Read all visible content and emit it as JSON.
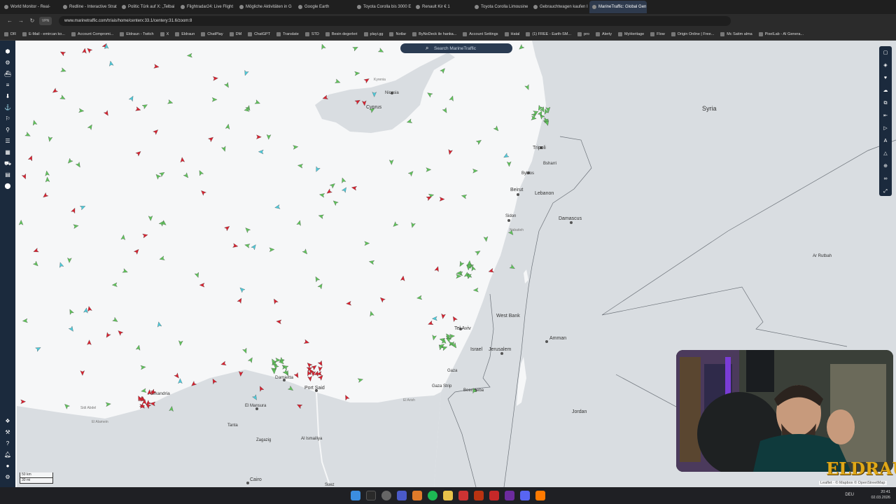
{
  "browser": {
    "tabs": [
      {
        "title": "World Monitor - Real-",
        "active": false
      },
      {
        "title": "Redline - Interactive Strat",
        "active": false
      },
      {
        "title": "Politic Türk auf X: „Telbai",
        "active": false
      },
      {
        "title": "Flightradar24: Live Flight",
        "active": false
      },
      {
        "title": "Mögliche Aktivitäten in G",
        "active": false
      },
      {
        "title": "Google Earth",
        "active": false
      },
      {
        "title": "Toyota Corolla bis 3000 E",
        "active": false
      },
      {
        "title": "Renault Kir € 1",
        "active": false
      },
      {
        "title": "Toyota Corolla Limousine",
        "active": false
      },
      {
        "title": "Gebrauchtwagen kaufen I",
        "active": false
      },
      {
        "title": "MarineTraffic: Global Gen",
        "active": true
      }
    ],
    "url": "www.marinetraffic.com/tr/ais/home/centerx:33.1/centery:31.6/zoom:8",
    "vpn_label": "VPN",
    "bookmarks": [
      "DR",
      "E-Mail - emircan ko...",
      "Account Compromi...",
      "Eldraun - Twitch",
      "X",
      "Eldraun",
      "ChatPlay",
      "DM",
      "ChatGPT",
      "Translate",
      "STD",
      "Besin degerleri",
      "playi.gg",
      "Notlar",
      "ByNoDeck ile hanka...",
      "Account Settings",
      "Hatal",
      "(1) FREE - Earth-SM...",
      "pro",
      "Alerty",
      "MyHeritage",
      "Flow",
      "Origin Online | Free...",
      "Mc Satim alma",
      "PixelLab - AI Genera..."
    ]
  },
  "map": {
    "search_placeholder": "Search MarineTraffic",
    "scale_top": "50 km",
    "scale_bottom": "30 mi",
    "attribution": "Leaflet · © Mapbox © OpenStreetMap",
    "labels": {
      "syria": "Syria",
      "lebanon": "Lebanon",
      "cyprus": "Cyprus",
      "nicosia": "Nicosia",
      "kyrenia": "Kyrenia",
      "tripoli": "Tripoli",
      "byblos": "Byblos",
      "beirut": "Beirut",
      "bsharri": "Bsharri",
      "sidon": "Sidon",
      "damascus": "Damascus",
      "nabatieh": "Nabatieh",
      "west_bank": "West Bank",
      "tel_aviv": "Tel Aviv",
      "israel": "Israel",
      "jerusalem": "Jerusalem",
      "amman": "Amman",
      "gaza": "Gaza",
      "gaza_strip": "Gaza Strip",
      "beersheba": "Beersheba",
      "jordan": "Jordan",
      "ar_rutbah": "Ar Rutbah",
      "alexandria": "Alexandria",
      "damietta": "Damietta",
      "port_said": "Port Said",
      "el_mansura": "El Mansura",
      "tanta": "Tanta",
      "zagazig": "Zagazig",
      "al_ismailiya": "Al Ismailiya",
      "cairo": "Cairo",
      "suez": "Suez",
      "el_arish": "El Arish",
      "sidi_abdel": "Sidi Abdel",
      "el_alamein": "El Alamein"
    }
  },
  "overlay": {
    "channel_logo": "ELDRAUN"
  },
  "taskbar": {
    "lang": "DEU",
    "time": "20:41",
    "date": "02.03.2026"
  },
  "colors": {
    "sea": "#f6f7f8",
    "land": "#d9dde1",
    "border": "#6b7178",
    "cargo": "#5fc35a",
    "tanker": "#d8202e",
    "passenger": "#2a76d6",
    "fishing": "#4cc9d9",
    "sidebar": "#1b2a3d"
  }
}
